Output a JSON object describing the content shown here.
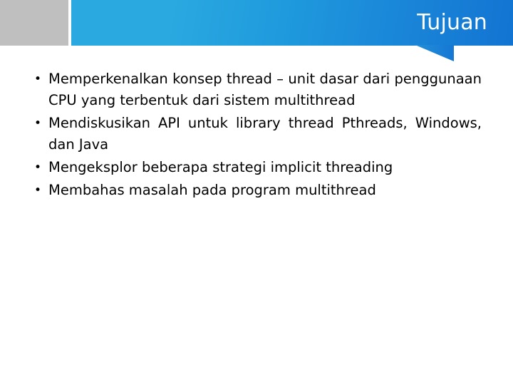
{
  "slide": {
    "title": "Tujuan",
    "bullet_marker": "•",
    "bullets": [
      {
        "id": "bullet-1",
        "text": "Memperkenalkan konsep thread – unit dasar dari penggunaan CPU yang terbentuk dari sistem multithread",
        "justified": true
      },
      {
        "id": "bullet-2",
        "text": "Mendiskusikan API untuk library thread Pthreads, Windows, dan Java",
        "justified": true
      },
      {
        "id": "bullet-3",
        "text": "Mengeksplor beberapa strategi implicit threading",
        "justified": false
      },
      {
        "id": "bullet-4",
        "text": "Membahas masalah pada program multithread",
        "justified": false
      }
    ]
  },
  "colors": {
    "header_blue_light": "#2aa9e0",
    "header_blue_mid": "#1e99dc",
    "header_blue_dark": "#1274d2",
    "header_gray": "#bfbfbf",
    "title_text": "#ffffff",
    "body_text": "#000000",
    "background": "#ffffff"
  }
}
